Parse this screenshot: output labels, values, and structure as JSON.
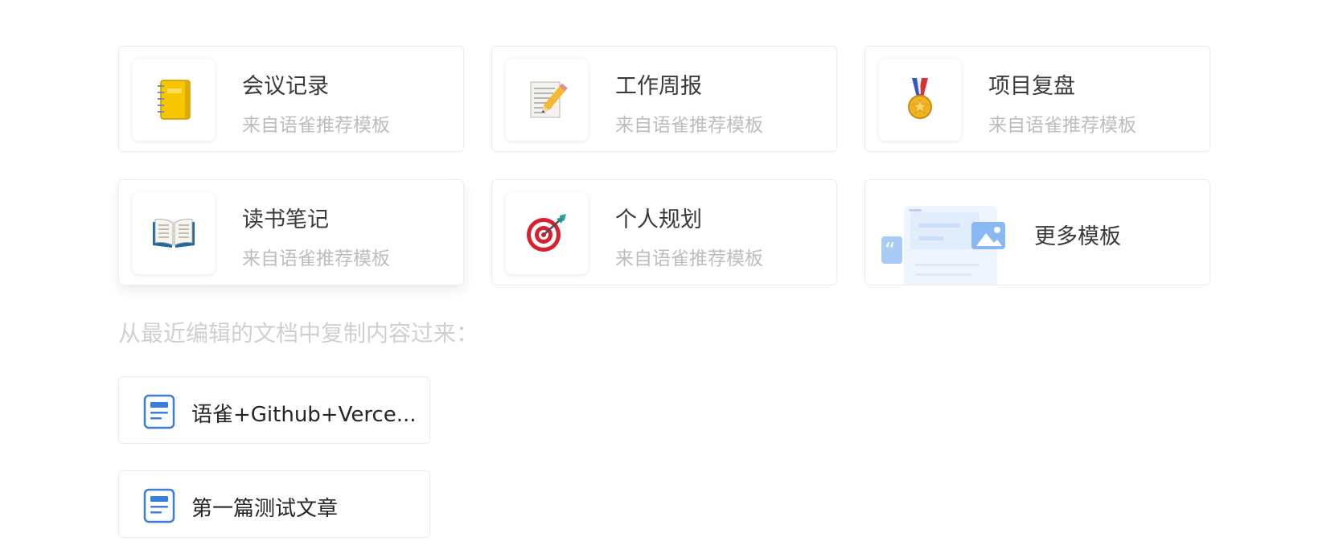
{
  "templates": [
    {
      "title": "会议记录",
      "subtitle": "来自语雀推荐模板",
      "icon": "notebook-icon"
    },
    {
      "title": "工作周报",
      "subtitle": "来自语雀推荐模板",
      "icon": "memo-pencil-icon"
    },
    {
      "title": "项目复盘",
      "subtitle": "来自语雀推荐模板",
      "icon": "medal-icon"
    },
    {
      "title": "读书笔记",
      "subtitle": "来自语雀推荐模板",
      "icon": "open-book-icon"
    },
    {
      "title": "个人规划",
      "subtitle": "来自语雀推荐模板",
      "icon": "target-icon"
    }
  ],
  "more": {
    "title": "更多模板",
    "icon": "template-illustration-icon"
  },
  "recent": {
    "title": "从最近编辑的文档中复制内容过来：",
    "docs": [
      {
        "title": "语雀+Github+Verce...",
        "icon": "document-icon"
      },
      {
        "title": "第一篇测试文章",
        "icon": "document-icon"
      }
    ]
  },
  "colors": {
    "border": "#ececec",
    "subtitle": "#bdbdbd",
    "doc_icon": "#3b7ddd",
    "illustration": "#8ab8f2"
  }
}
